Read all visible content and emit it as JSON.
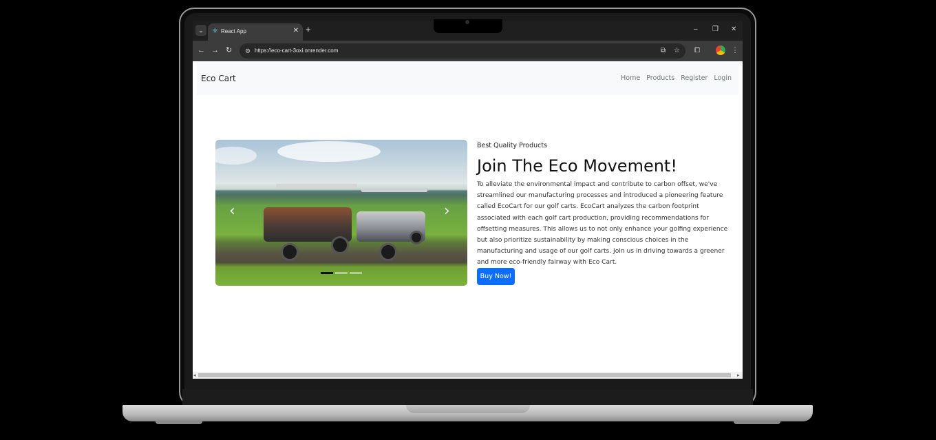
{
  "browser": {
    "tab": {
      "title": "React App",
      "icon": "react-icon"
    },
    "url": "https://eco-cart-3oxi.onrender.com"
  },
  "site": {
    "brand": "Eco Cart",
    "nav": [
      "Home",
      "Products",
      "Register",
      "Login"
    ]
  },
  "hero": {
    "eyebrow": "Best Quality Products",
    "headline": "Join The Eco Movement!",
    "description": "To alleviate the environmental impact and contribute to carbon offset, we've streamlined our manufacturing processes and introduced a pioneering feature called EcoCart for our golf carts. EcoCart analyzes the carbon footprint associated with each golf cart production, providing recommendations for offsetting measures. This allows us to not only enhance your golfing experience but also prioritize sustainability by making conscious choices in the manufacturing and usage of our golf carts. Join us in driving towards a greener and more eco-friendly fairway with Eco Cart.",
    "button": "Buy Now!"
  },
  "carousel": {
    "slides": 3,
    "active": 1,
    "image": "golf-carts-on-green-photo"
  },
  "colors": {
    "primary": "#0d6efd",
    "navbar_bg": "#f8f9fa",
    "browser_chrome": "#3c3c3c"
  }
}
